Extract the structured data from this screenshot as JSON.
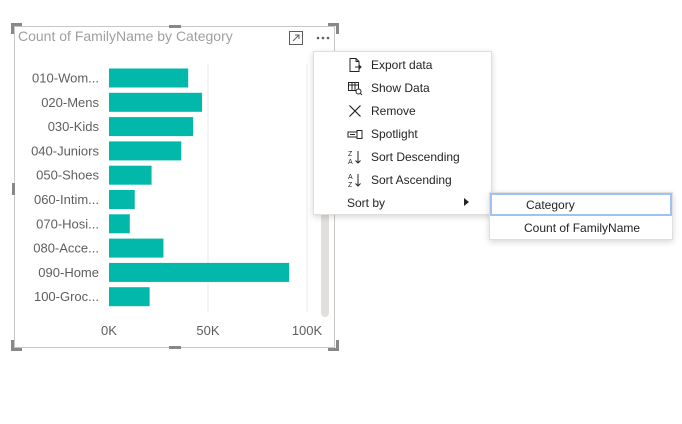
{
  "visual": {
    "title": "Count of FamilyName by Category",
    "header_icons": [
      "focus-mode-icon",
      "more-options-icon"
    ]
  },
  "chart_data": {
    "type": "bar",
    "orientation": "horizontal",
    "title": "Count of FamilyName by Category",
    "categories": [
      "010-Wom...",
      "020-Mens",
      "030-Kids",
      "040-Juniors",
      "050-Shoes",
      "060-Intim...",
      "070-Hosi...",
      "080-Acce...",
      "090-Home",
      "100-Groc..."
    ],
    "values": [
      40000,
      47000,
      42500,
      36500,
      21500,
      13000,
      10500,
      27500,
      91000,
      20500
    ],
    "x_ticks": [
      "0K",
      "50K",
      "100K"
    ],
    "xlim": [
      0,
      100000
    ],
    "grid": true,
    "bar_color": "#01B8AA"
  },
  "context_menu": {
    "items": [
      {
        "label": "Export data",
        "icon": "export-data-icon"
      },
      {
        "label": "Show Data",
        "icon": "show-data-icon"
      },
      {
        "label": "Remove",
        "icon": "remove-icon"
      },
      {
        "label": "Spotlight",
        "icon": "spotlight-icon"
      },
      {
        "label": "Sort Descending",
        "icon": "sort-descending-icon"
      },
      {
        "label": "Sort Ascending",
        "icon": "sort-ascending-icon"
      },
      {
        "label": "Sort by",
        "icon": "chevron-right-icon"
      }
    ]
  },
  "sort_submenu": {
    "items": [
      {
        "label": "Category",
        "selected": true
      },
      {
        "label": "Count of FamilyName",
        "selected": false
      }
    ]
  }
}
